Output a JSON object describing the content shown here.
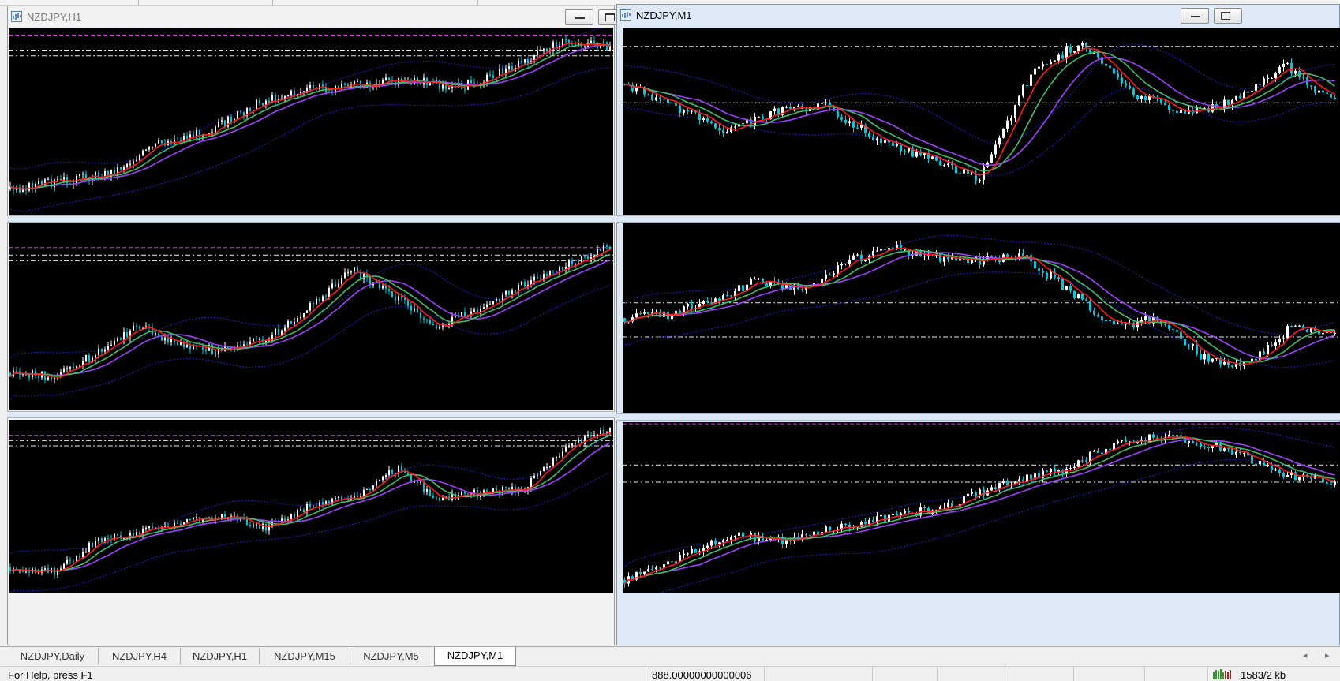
{
  "colors": {
    "background": "#000000",
    "candle_up": "#ffffff",
    "candle_down": "#00c8d8",
    "ma_fast": "#ff1a1a",
    "ma_mid": "#3fbf6a",
    "ma_slow": "#a040ff",
    "band": "#2020c8",
    "level_magenta": "#ff20ff",
    "level_white": "#e8e8e8",
    "active_frame": "#dde9f6"
  },
  "windows": [
    {
      "title": "NZDJPY,H1",
      "active": false,
      "icon": "chart-window-icon"
    },
    {
      "title": "NZDJPY,M1",
      "active": true,
      "icon": "chart-window-icon"
    }
  ],
  "tabs": [
    {
      "label": "NZDJPY,Daily",
      "active": false
    },
    {
      "label": "NZDJPY,H4",
      "active": false
    },
    {
      "label": "NZDJPY,H1",
      "active": false
    },
    {
      "label": "NZDJPY,M15",
      "active": false
    },
    {
      "label": "NZDJPY,M5",
      "active": false
    },
    {
      "label": "NZDJPY,M1",
      "active": true
    }
  ],
  "tab_nav": {
    "prev": "◂",
    "next": "▸"
  },
  "status": {
    "help": "For Help, press F1",
    "value": "888.00000000000006",
    "traffic": "1583/2 kb"
  }
}
